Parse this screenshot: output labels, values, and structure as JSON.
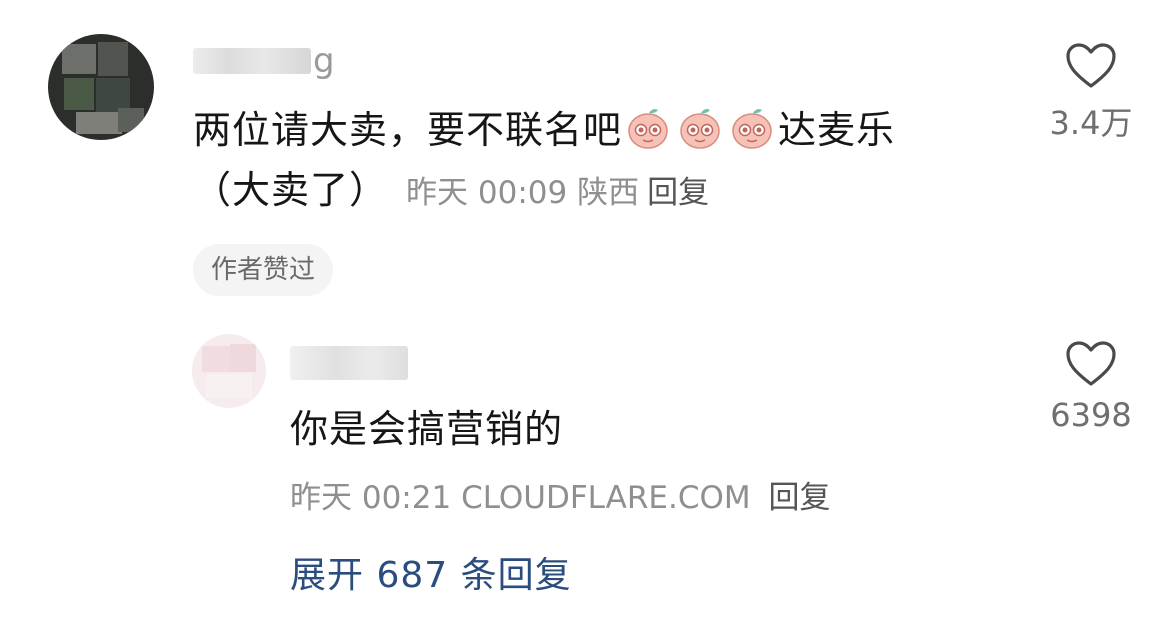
{
  "main_comment": {
    "username_visible_suffix": "g",
    "text_before_emojis": "两位请大卖，要不联名吧",
    "emoji_count": 3,
    "emoji_icon": "pink-peach-face-emoji",
    "text_after_emojis": "达麦乐",
    "text_line2": "（大卖了）",
    "time": "昨天 00:09",
    "location": "陕西",
    "reply_label": "回复",
    "author_liked_badge": "作者赞过",
    "like_count": "3.4万"
  },
  "reply_comment": {
    "text": "你是会搞营销的",
    "time": "昨天 00:21",
    "location": "CLOUDFLARE.COM",
    "reply_label": "回复",
    "like_count": "6398"
  },
  "expand_replies": {
    "label": "展开 687 条回复"
  },
  "colors": {
    "text_primary": "#161616",
    "text_meta": "#8f8f8f",
    "link_blue": "#2b4d7e",
    "heart_outline": "#4a4a4a"
  },
  "icons": [
    "heart-outline-icon",
    "pink-peach-face-emoji"
  ]
}
